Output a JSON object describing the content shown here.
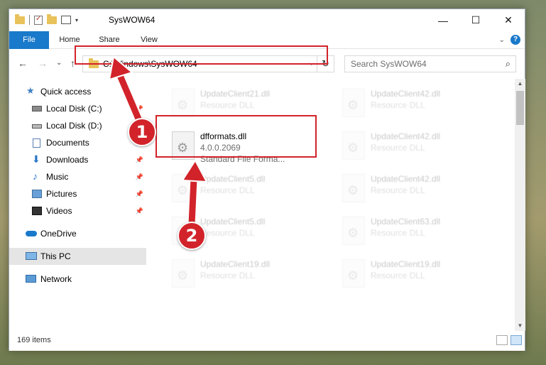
{
  "window": {
    "title": "SysWOW64",
    "controls": {
      "minimize": "—",
      "maximize": "☐",
      "close": "✕"
    }
  },
  "ribbon": {
    "tabs": [
      "File",
      "Home",
      "Share",
      "View"
    ],
    "help": "?",
    "collapse": "⌄"
  },
  "nav": {
    "back": "←",
    "forward": "→",
    "recent": "⌄",
    "up": "↑",
    "address": "C:\\Windows\\SysWOW64",
    "address_dropdown": "⌵",
    "refresh": "↻",
    "search_placeholder": "Search SysWOW64"
  },
  "sidebar": {
    "items": [
      {
        "label": "Quick access",
        "icon": "star-icon",
        "pinned": false
      },
      {
        "label": "Local Disk (C:)",
        "icon": "drive-icon",
        "pinned": true
      },
      {
        "label": "Local Disk (D:)",
        "icon": "drive-icon",
        "pinned": true
      },
      {
        "label": "Documents",
        "icon": "documents-icon",
        "pinned": true
      },
      {
        "label": "Downloads",
        "icon": "download-icon",
        "pinned": true
      },
      {
        "label": "Music",
        "icon": "music-icon",
        "pinned": true
      },
      {
        "label": "Pictures",
        "icon": "pictures-icon",
        "pinned": true
      },
      {
        "label": "Videos",
        "icon": "videos-icon",
        "pinned": true
      },
      {
        "label": "OneDrive",
        "icon": "cloud-icon",
        "pinned": false
      },
      {
        "label": "This PC",
        "icon": "computer-icon",
        "pinned": false,
        "selected": true
      },
      {
        "label": "Network",
        "icon": "network-icon",
        "pinned": false
      }
    ]
  },
  "files": {
    "highlighted": {
      "name": "dfformats.dll",
      "version": "4.0.0.2069",
      "type": "Standard File Forma..."
    },
    "background": [
      {
        "name": "UpdateClient21.dll",
        "type": "Resource DLL"
      },
      {
        "name": "UpdateClient42.dll",
        "type": "Resource DLL"
      },
      {
        "name": "UpdateClient42.dll",
        "type": "Resource DLL"
      },
      {
        "name": "UpdateClient5.dll",
        "type": "Resource DLL"
      },
      {
        "name": "UpdateClient42.dll",
        "type": "Resource DLL"
      },
      {
        "name": "UpdateClient5.dll",
        "type": "Resource DLL"
      },
      {
        "name": "UpdateClient63.dll",
        "type": "Resource DLL"
      },
      {
        "name": "UpdateClient19.dll",
        "type": "Resource DLL"
      },
      {
        "name": "UpdateClient19.dll",
        "type": "Resource DLL"
      }
    ]
  },
  "status": {
    "items_count": "169 items"
  },
  "annotations": {
    "step1": "1",
    "step2": "2"
  },
  "colors": {
    "accent": "#1979ca",
    "highlight": "#d2232a",
    "folder": "#e8c25a"
  }
}
